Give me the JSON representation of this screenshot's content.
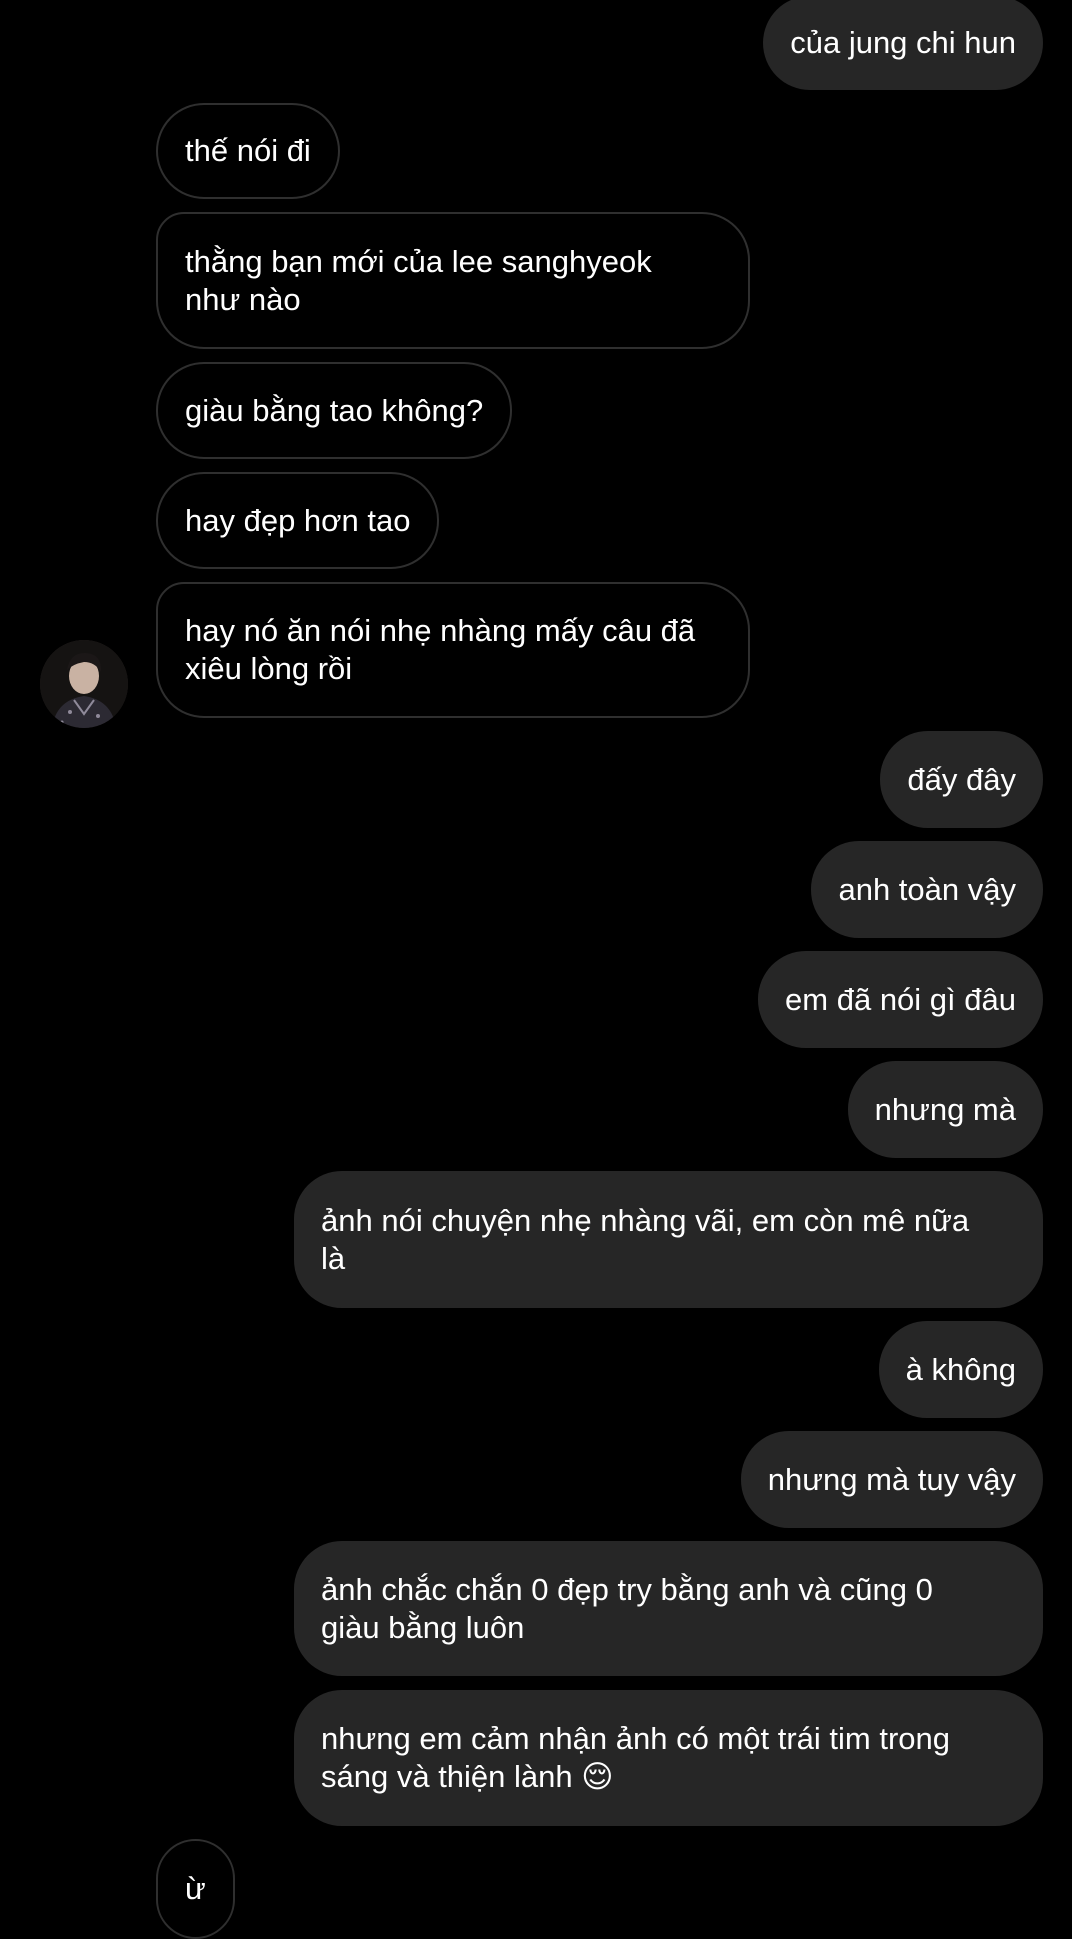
{
  "messages": [
    {
      "id": "m1",
      "side": "out",
      "text": "của jung chi hun"
    },
    {
      "id": "m2",
      "side": "in",
      "text": "thế nói đi"
    },
    {
      "id": "m3",
      "side": "in",
      "text": "thằng bạn mới của lee sanghyeok\nnhư nào"
    },
    {
      "id": "m4",
      "side": "in",
      "text": "giàu bằng tao không?"
    },
    {
      "id": "m5",
      "side": "in",
      "text": "hay đẹp hơn tao"
    },
    {
      "id": "m6",
      "side": "in",
      "text": "hay nó ăn nói nhẹ nhàng mấy câu đã\nxiêu lòng rồi"
    },
    {
      "id": "m7",
      "side": "out",
      "text": "đấy đây"
    },
    {
      "id": "m8",
      "side": "out",
      "text": "anh toàn vậy"
    },
    {
      "id": "m9",
      "side": "out",
      "text": "em đã nói gì đâu"
    },
    {
      "id": "m10",
      "side": "out",
      "text": "nhưng mà"
    },
    {
      "id": "m11",
      "side": "out",
      "text": "ảnh nói chuyện nhẹ nhàng vãi, em còn mê nữa\nlà"
    },
    {
      "id": "m12",
      "side": "out",
      "text": "à không"
    },
    {
      "id": "m13",
      "side": "out",
      "text": "nhưng mà tuy vậy"
    },
    {
      "id": "m14",
      "side": "out",
      "text": "ảnh chắc chắn 0 đẹp try bằng anh và cũng 0\ngiàu bằng luôn"
    },
    {
      "id": "m15",
      "side": "out",
      "text": "nhưng em cảm nhận ảnh có một trái tim trong\nsáng và thiện lành 😌"
    },
    {
      "id": "m16",
      "side": "in",
      "text": "ừ"
    }
  ],
  "colors": {
    "background": "#000000",
    "outgoing_bubble": "#262626",
    "incoming_border": "#2f2f2f",
    "text": "#ffffff"
  },
  "avatar": {
    "icon": "user-avatar-photo"
  }
}
